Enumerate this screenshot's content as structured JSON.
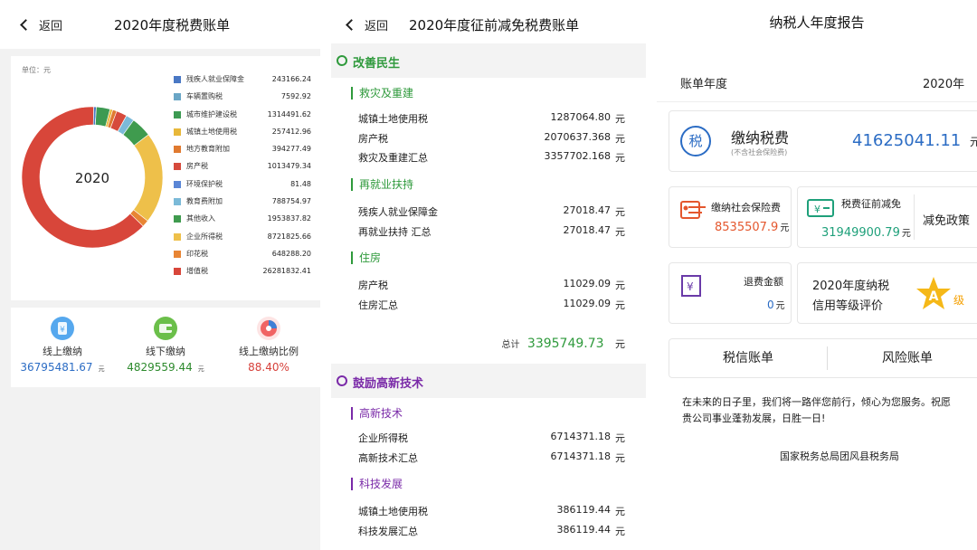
{
  "panel1": {
    "back": "返回",
    "title": "2020年度税费账单",
    "unit": "单位：元",
    "center": "2020",
    "legend": [
      {
        "name": "残疾人就业保障金",
        "value": "243166.24",
        "color": "#4a78c4"
      },
      {
        "name": "车辆置购税",
        "value": "7592.92",
        "color": "#6aa6c6"
      },
      {
        "name": "城市维护建设税",
        "value": "1314491.62",
        "color": "#3d9a52"
      },
      {
        "name": "城镇土地使用税",
        "value": "257412.96",
        "color": "#e8b83a"
      },
      {
        "name": "地方教育附加",
        "value": "394277.49",
        "color": "#e07a30"
      },
      {
        "name": "房产税",
        "value": "1013479.34",
        "color": "#d64a3c"
      },
      {
        "name": "环境保护税",
        "value": "81.48",
        "color": "#5a86d6"
      },
      {
        "name": "教育费附加",
        "value": "788754.97",
        "color": "#7bbad8"
      },
      {
        "name": "其他收入",
        "value": "1953837.82",
        "color": "#3f9b4e"
      },
      {
        "name": "企业所得税",
        "value": "8721825.66",
        "color": "#eec04a"
      },
      {
        "name": "印花税",
        "value": "648288.20",
        "color": "#e88534"
      },
      {
        "name": "增值税",
        "value": "26281832.41",
        "color": "#d8463a"
      }
    ],
    "stats": [
      {
        "label": "线上缴纳",
        "value": "36795481.67",
        "unit": "元",
        "color": "#2b6cc4",
        "icon": "yuan-icon",
        "iconColor": "#56a8ee"
      },
      {
        "label": "线下缴纳",
        "value": "4829559.44",
        "unit": "元",
        "color": "#2d8a2d",
        "icon": "wallet-icon",
        "iconColor": "#6bbf4a"
      },
      {
        "label": "线上缴纳比例",
        "value": "88.40%",
        "unit": "",
        "color": "#d6403a",
        "icon": "pie-chart-icon",
        "iconColor": "#f06464"
      }
    ]
  },
  "panel2": {
    "back": "返回",
    "title": "2020年度征前减免税费账单",
    "sections": [
      {
        "title": "改善民生",
        "color": "#2f9a3c",
        "icon": "check-circle-icon"
      },
      {
        "title": "鼓励高新技术",
        "color": "#7a2aa8",
        "icon": "target-icon"
      }
    ],
    "groups": [
      {
        "title": "救灾及重建",
        "color": "#2f9a3c",
        "items": [
          {
            "name": "城镇土地使用税",
            "value": "1287064.80",
            "unit": "元"
          },
          {
            "name": "房产税",
            "value": "2070637.368",
            "unit": "元"
          },
          {
            "name": "救灾及重建汇总",
            "value": "3357702.168",
            "unit": "元"
          }
        ]
      },
      {
        "title": "再就业扶持",
        "color": "#2f9a3c",
        "items": [
          {
            "name": "残疾人就业保障金",
            "value": "27018.47",
            "unit": "元"
          },
          {
            "name": "再就业扶持 汇总",
            "value": "27018.47",
            "unit": "元"
          }
        ]
      },
      {
        "title": "住房",
        "color": "#2f9a3c",
        "items": [
          {
            "name": "房产税",
            "value": "11029.09",
            "unit": "元"
          },
          {
            "name": "住房汇总",
            "value": "11029.09",
            "unit": "元"
          }
        ]
      },
      {
        "title": "高新技术",
        "color": "#7a2aa8",
        "items": [
          {
            "name": "企业所得税",
            "value": "6714371.18",
            "unit": "元"
          },
          {
            "name": "高新技术汇总",
            "value": "6714371.18",
            "unit": "元"
          }
        ]
      },
      {
        "title": "科技发展",
        "color": "#7a2aa8",
        "items": [
          {
            "name": "城镇土地使用税",
            "value": "386119.44",
            "unit": "元"
          },
          {
            "name": "科技发展汇总",
            "value": "386119.44",
            "unit": "元"
          }
        ]
      }
    ],
    "total": {
      "label": "总计",
      "value": "3395749.73",
      "unit": "元"
    }
  },
  "panel3": {
    "title": "纳税人年度报告",
    "year_label": "账单年度",
    "year_value": "2020年",
    "pay_title": "缴纳税费",
    "pay_sub": "(不含社会保险费)",
    "pay_value": "41625041.11",
    "pay_unit": "元",
    "tax_icon_char": "税",
    "social_label": "缴纳社会保险费",
    "social_value": "8535507.9",
    "social_unit": "元",
    "reduce_label": "税费征前减免",
    "reduce_value": "31949900.79",
    "reduce_unit": "元",
    "policy_label": "减免政策",
    "refund_label": "退费金额",
    "refund_value": "0",
    "refund_unit": "元",
    "credit_line1": "2020年度纳税",
    "credit_line2": "信用等级评价",
    "credit_grade": "A",
    "credit_suffix": "级",
    "btn_credit": "税信账单",
    "btn_risk": "风险账单",
    "footer_line1": "在未来的日子里，我们将一路伴您前行，倾心为您服务。祝愿",
    "footer_line2": "贵公司事业蓬勃发展，日胜一日!",
    "signature": "国家税务总局团风县税务局"
  }
}
